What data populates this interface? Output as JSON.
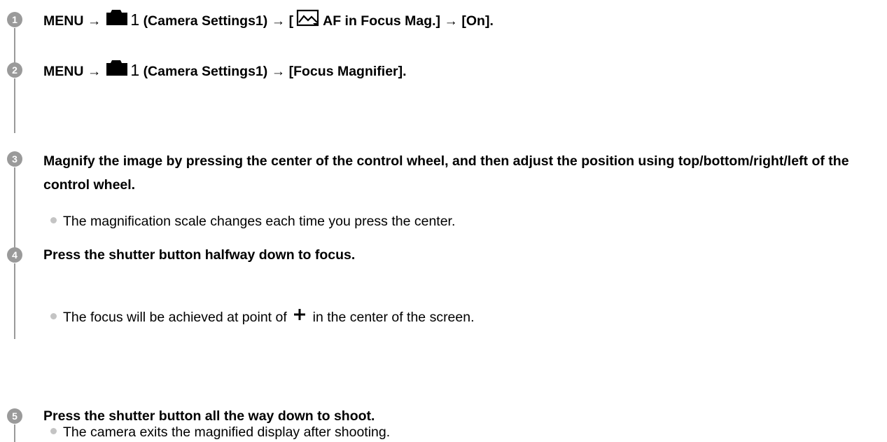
{
  "steps": [
    {
      "number": "1",
      "parts": {
        "prefix": "MENU →",
        "cam_num": "1",
        "middle": "(Camera Settings1) → [",
        "suffix": "AF in Focus Mag.] → [On]."
      },
      "icons": [
        "camera-icon",
        "af-in-focus-mag-icon"
      ]
    },
    {
      "number": "2",
      "parts": {
        "prefix": "MENU →",
        "cam_num": "1",
        "suffix": "(Camera Settings1) → [Focus Magnifier]."
      },
      "icons": [
        "camera-icon"
      ]
    },
    {
      "number": "3",
      "title": "Magnify the image by pressing the center of the control wheel, and then adjust the position using top/bottom/right/left of the control wheel.",
      "bullet": "The magnification scale changes each time you press the center."
    },
    {
      "number": "4",
      "title": "Press the shutter button halfway down to focus.",
      "bullet_prefix": "The focus will be achieved at point of",
      "bullet_suffix": "in the center of the screen.",
      "icons": [
        "plus-icon"
      ]
    },
    {
      "number": "5",
      "title": "Press the shutter button all the way down to shoot.",
      "bullet": "The camera exits the magnified display after shooting."
    }
  ],
  "colors": {
    "rail": "#9a9a9a",
    "badge": "#9a9a9a",
    "bullet_dot": "#c4c4c4",
    "text": "#000000"
  }
}
